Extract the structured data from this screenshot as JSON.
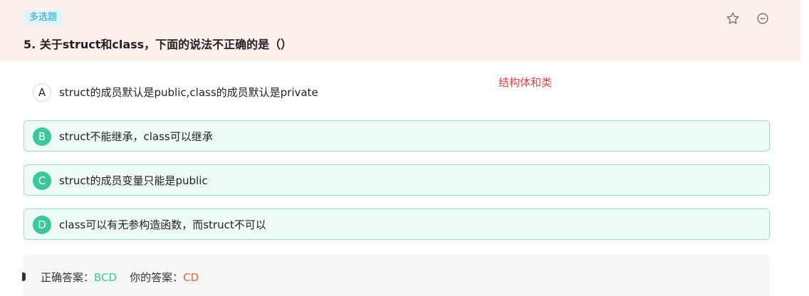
{
  "question": {
    "type_tag": "多选题",
    "title": "5. 关于struct和class，下面的说法不正确的是（）"
  },
  "header_icons": {
    "favorite": "star-outline-icon",
    "remove": "minus-circle-icon"
  },
  "note": "结构体和类",
  "options": [
    {
      "letter": "A",
      "text": "struct的成员默认是public,class的成员默认是private",
      "selected": false
    },
    {
      "letter": "B",
      "text": "struct不能继承，class可以继承",
      "selected": true
    },
    {
      "letter": "C",
      "text": "struct的成员变量只能是public",
      "selected": true
    },
    {
      "letter": "D",
      "text": "class可以有无参构造函数，而struct不可以",
      "selected": true
    }
  ],
  "answer": {
    "correct_label": "正确答案：",
    "correct_value": "BCD",
    "mine_label": "你的答案：",
    "mine_value": "CD"
  },
  "colors": {
    "header_bg": "#fdefea",
    "selected_accent": "#3cc79a",
    "correct": "#3cc79a",
    "wrong": "#f06232",
    "note": "#e04545"
  }
}
